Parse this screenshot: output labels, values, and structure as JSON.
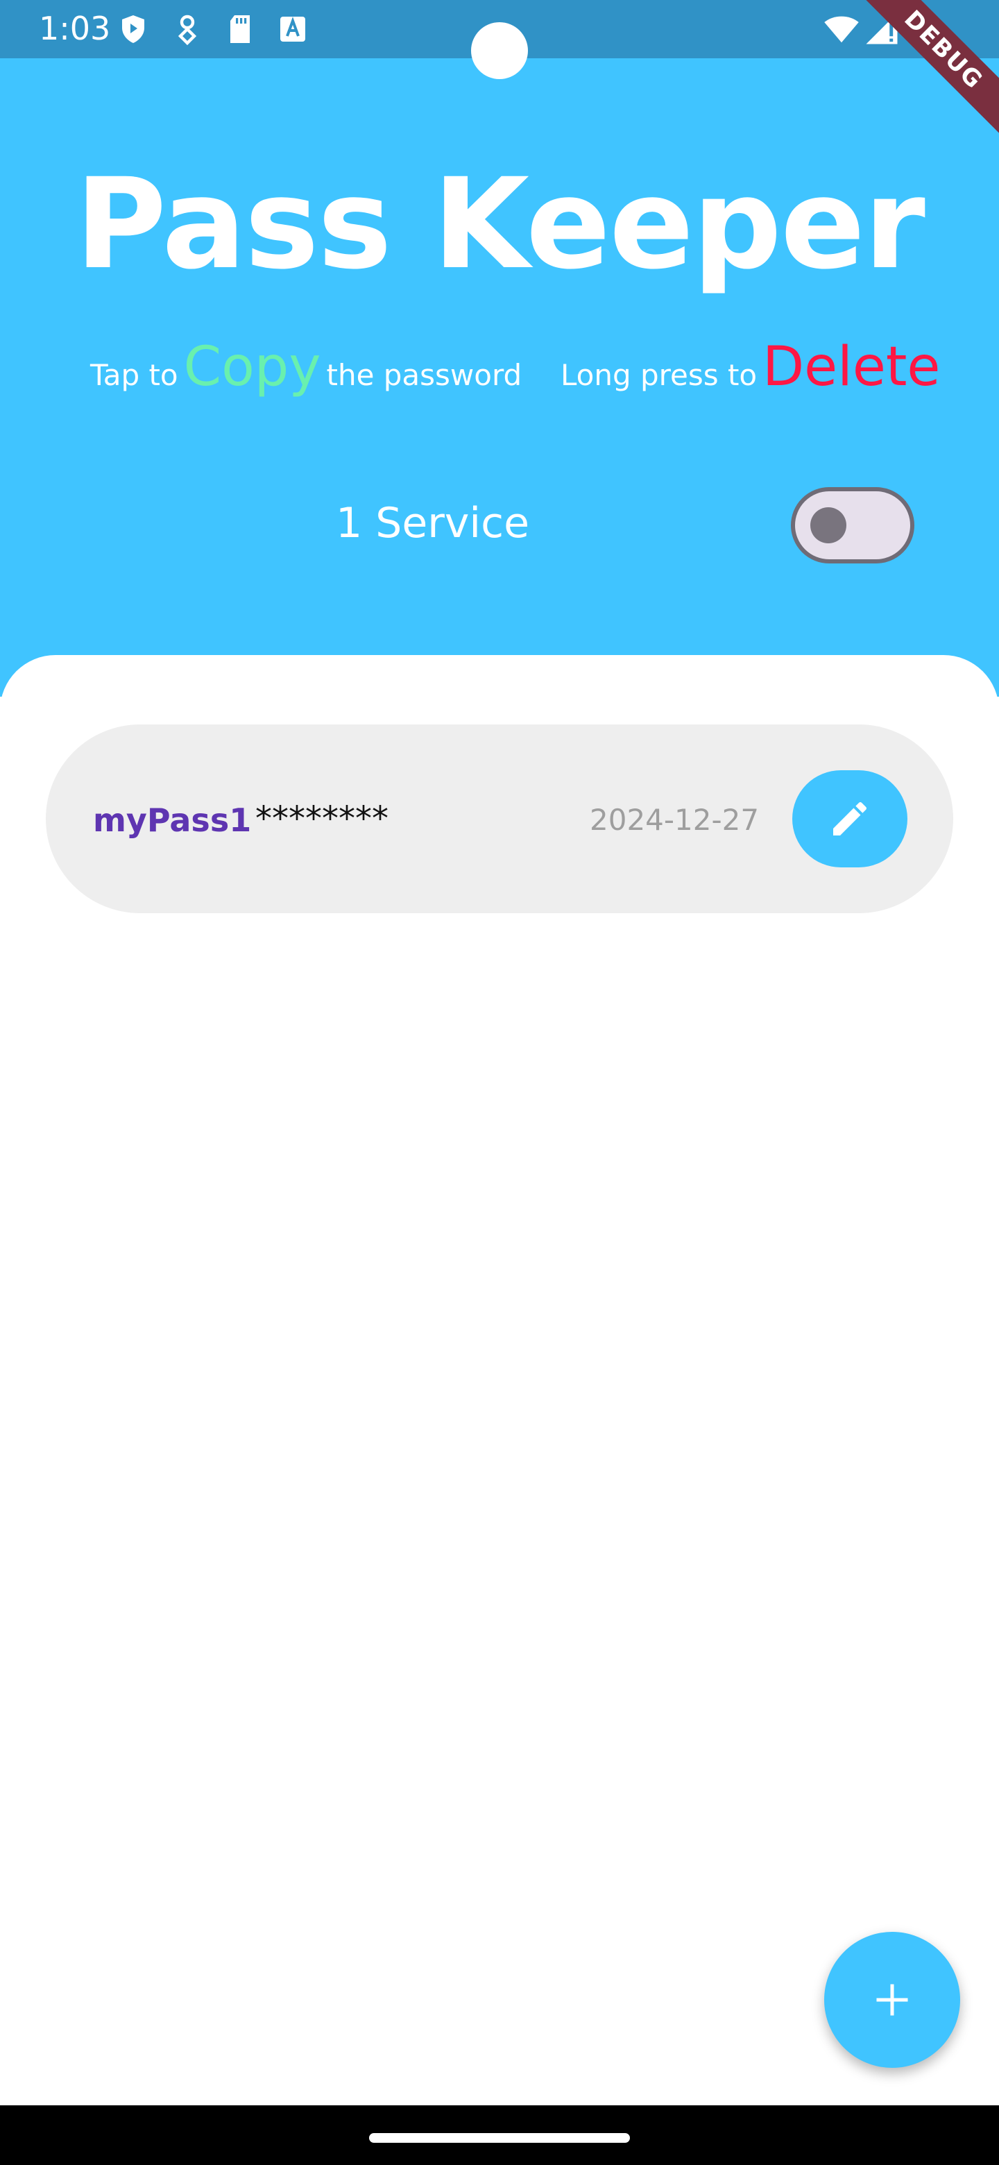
{
  "status_bar": {
    "time": "1:03",
    "left_icons": [
      "shield-icon",
      "pin-icon",
      "sd-card-icon",
      "font-icon"
    ],
    "right_icons": [
      "wifi-icon",
      "signal-icon",
      "battery-icon"
    ]
  },
  "debug_banner": "DEBUG",
  "header": {
    "title": "Pass Keeper",
    "hint_copy": {
      "prefix": "Tap to",
      "action": "Copy",
      "suffix": "the password"
    },
    "hint_delete": {
      "prefix": "Long press to",
      "action": "Delete"
    },
    "service_count": "1 Service",
    "toggle_on": false
  },
  "passwords": [
    {
      "name": "myPass1",
      "masked": "********",
      "date": "2024-12-27"
    }
  ],
  "colors": {
    "header_bg": "#40c4ff",
    "status_bg": "#3092c6",
    "copy_accent": "#69f0ae",
    "delete_accent": "#ff1744",
    "name_color": "#5e35b1"
  }
}
